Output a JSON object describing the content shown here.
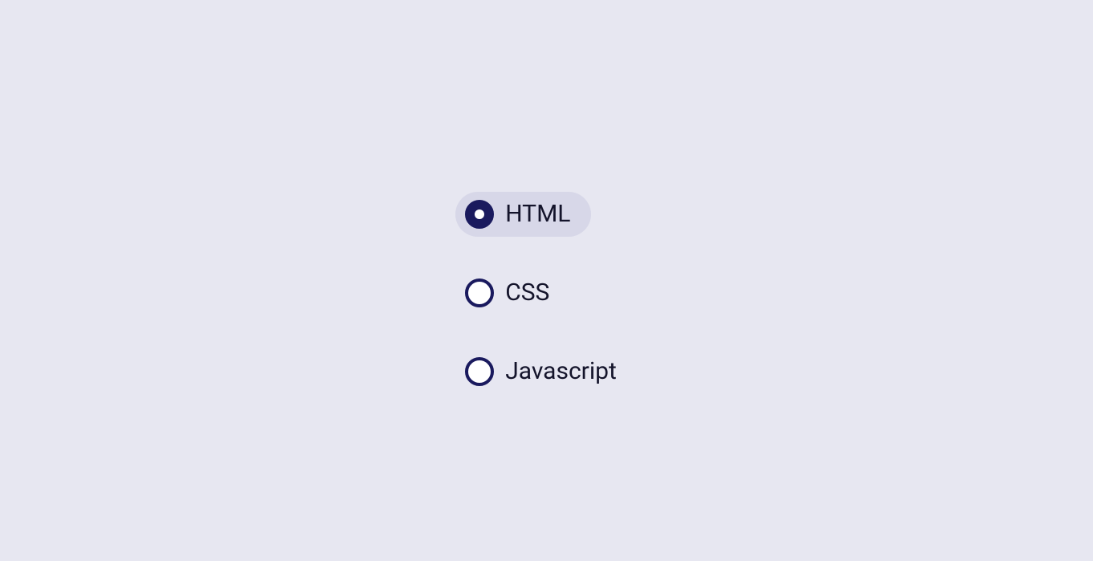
{
  "radioGroup": {
    "options": [
      {
        "label": "HTML",
        "selected": true
      },
      {
        "label": "CSS",
        "selected": false
      },
      {
        "label": "Javascript",
        "selected": false
      }
    ]
  }
}
